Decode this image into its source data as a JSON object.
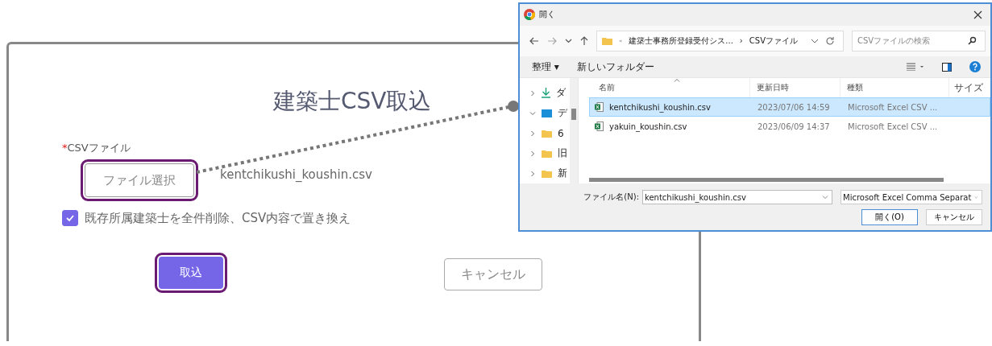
{
  "modal": {
    "title": "建築士CSV取込",
    "field_label": "CSVファイル",
    "required_mark": "*",
    "file_button": {
      "label": "ファイル選択",
      "highlighted": true
    },
    "file_name": "kentchikushi_koushin.csv",
    "checkbox": {
      "label": "既存所属建築士を全件削除、CSV内容で置き換え",
      "checked": true
    },
    "buttons": [
      {
        "label": "取込",
        "kind": "primary",
        "highlighted": true
      },
      {
        "label": "キャンセル",
        "kind": "secondary",
        "highlighted": false
      }
    ]
  },
  "file_dialog": {
    "title": "開く",
    "path": [
      "«",
      "建築士事務所登録受付シス...",
      "›",
      "CSVファイル"
    ],
    "search": {
      "placeholder": "CSVファイルの検索"
    },
    "toolbar": [
      "整理 ▾",
      "新しいフォルダー"
    ],
    "nav": [
      {
        "label": "ダ",
        "kind": "download",
        "expanded": false
      },
      {
        "label": "デ",
        "kind": "desktop",
        "expanded": true
      },
      {
        "label": "6",
        "kind": "folder",
        "expanded": false
      },
      {
        "label": "旧",
        "kind": "folder",
        "expanded": false
      },
      {
        "label": "新",
        "kind": "folder",
        "expanded": false
      }
    ],
    "columns": [
      "名前",
      "更新日時",
      "種類",
      "サイズ"
    ],
    "rows": [
      {
        "name": "kentchikushi_koushin.csv",
        "date": "2023/07/06 14:59",
        "type": "Microsoft Excel CSV ...",
        "selected": true
      },
      {
        "name": "yakuin_koushin.csv",
        "date": "2023/06/09 14:37",
        "type": "Microsoft Excel CSV ...",
        "selected": false
      }
    ],
    "filename_label": "ファイル名(N):",
    "filename": "kentchikushi_koushin.csv",
    "filetype": "Microsoft Excel Comma Separat",
    "buttons": [
      "開く(O)",
      "キャンセル"
    ]
  }
}
